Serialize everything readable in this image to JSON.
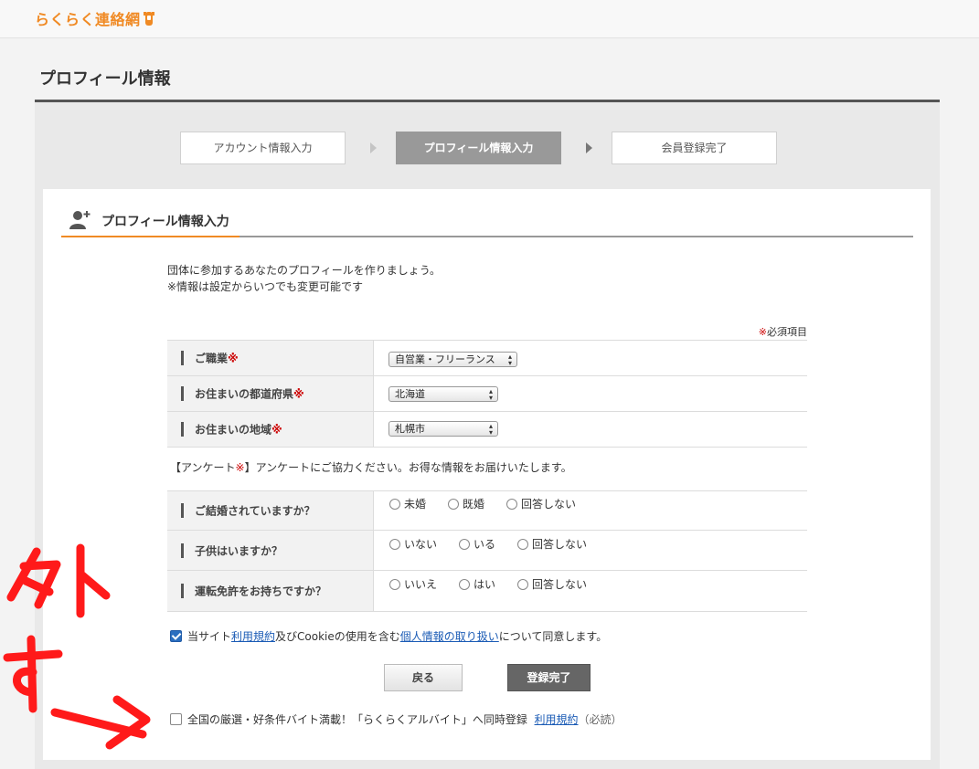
{
  "header": {
    "logo": "らくらく連絡網"
  },
  "page_title": "プロフィール情報",
  "steps": [
    {
      "label": "アカウント情報入力"
    },
    {
      "label": "プロフィール情報入力"
    },
    {
      "label": "会員登録完了"
    }
  ],
  "section": {
    "title": "プロフィール情報入力",
    "intro_line1": "団体に参加するあなたのプロフィールを作りましょう。",
    "intro_line2": "※情報は設定からいつでも変更可能です",
    "required_mark": "※",
    "required_label": "必須項目"
  },
  "fields": [
    {
      "label": "ご職業",
      "mark": "※",
      "value": "自営業・フリーランス"
    },
    {
      "label": "お住まいの都道府県",
      "mark": "※",
      "value": "北海道"
    },
    {
      "label": "お住まいの地域",
      "mark": "※",
      "value": "札幌市"
    }
  ],
  "survey": {
    "open": "【アンケート",
    "mark": "※",
    "close": "】アンケートにご協力ください。お得な情報をお届けいたします。"
  },
  "questions": [
    {
      "label": "ご結婚されていますか？",
      "options": [
        "未婚",
        "既婚",
        "回答しない"
      ]
    },
    {
      "label": "子供はいますか？",
      "options": [
        "いない",
        "いる",
        "回答しない"
      ]
    },
    {
      "label": "運転免許をお持ちですか？",
      "options": [
        "いいえ",
        "はい",
        "回答しない"
      ]
    }
  ],
  "agreement": {
    "checked": true,
    "prefix": "当サイト",
    "terms_link": "利用規約",
    "middle": "及びCookieの使用を含む",
    "privacy_link": "個人情報の取り扱い",
    "suffix": "について同意します。"
  },
  "buttons": {
    "back": "戻る",
    "submit": "登録完了"
  },
  "arbeit": {
    "checked": false,
    "text": "全国の厳選・好条件バイト満載！「らくらくアルバイト」へ同時登録",
    "terms_link": "利用規約",
    "note": "（必読）"
  },
  "annotation": {
    "color": "#ff1a1a",
    "handwritten_text": "外す"
  },
  "colors": {
    "accent": "#f08a24",
    "required": "#cc0000",
    "link": "#1a5bb5",
    "active_step": "#999999",
    "submit_button": "#666666"
  }
}
